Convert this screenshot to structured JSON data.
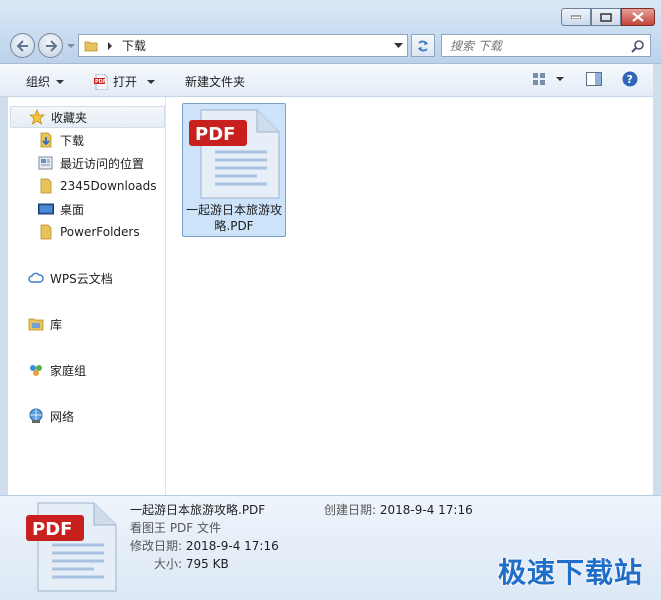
{
  "address": {
    "current_folder": "下载"
  },
  "search": {
    "placeholder": "搜索 下载"
  },
  "toolbar": {
    "organize": "组织",
    "open": "打开",
    "new_folder": "新建文件夹"
  },
  "sidebar": {
    "favorites": "收藏夹",
    "items": [
      {
        "label": "下载",
        "icon": "download-folder-icon"
      },
      {
        "label": "最近访问的位置",
        "icon": "recent-places-icon"
      },
      {
        "label": "2345Downloads",
        "icon": "folder-icon"
      },
      {
        "label": "桌面",
        "icon": "desktop-icon"
      },
      {
        "label": "PowerFolders",
        "icon": "folder-icon"
      }
    ],
    "groups": [
      {
        "label": "WPS云文档",
        "icon": "cloud-icon"
      },
      {
        "label": "库",
        "icon": "library-icon"
      },
      {
        "label": "家庭组",
        "icon": "homegroup-icon"
      },
      {
        "label": "网络",
        "icon": "network-icon"
      }
    ]
  },
  "file": {
    "badge": "PDF",
    "name": "一起游日本旅游攻略.PDF"
  },
  "details": {
    "name": "一起游日本旅游攻略.PDF",
    "type": "看图王 PDF 文件",
    "modified_label": "修改日期:",
    "modified_value": "2018-9-4 17:16",
    "size_label": "大小:",
    "size_value": "795 KB",
    "created_label": "创建日期:",
    "created_value": "2018-9-4 17:16"
  },
  "watermark": "极速下载站",
  "colors": {
    "accent": "#1f6ec9",
    "selection": "#cce3fa",
    "pdf_red": "#c8201d"
  }
}
